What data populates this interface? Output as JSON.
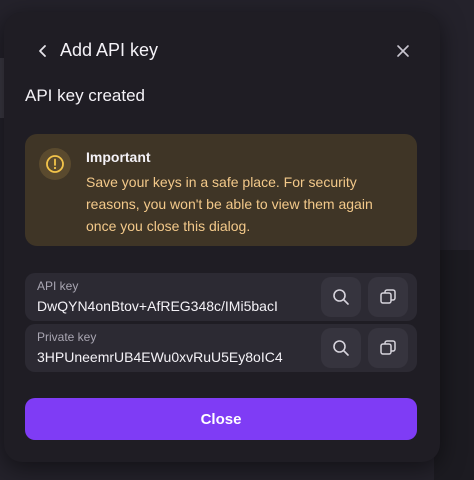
{
  "dialog": {
    "title": "Add API key",
    "subtitle": "API key created",
    "warning": {
      "title": "Important",
      "text": "Save your keys in a safe place. For security reasons, you won't be able to view them again once you close this dialog.",
      "icon": "exclamation-circle-icon"
    },
    "api_key": {
      "label": "API key",
      "value": "DwQYN4onBtov+AfREG348c/IMi5bacI"
    },
    "private_key": {
      "label": "Private key",
      "value": "3HPUneemrUB4EWu0xvRuU5Ey8oIC4"
    },
    "close_label": "Close"
  },
  "colors": {
    "accent": "#7f3cf5",
    "warning_bg": "#3f3526",
    "warning_text": "#f3c98a"
  }
}
